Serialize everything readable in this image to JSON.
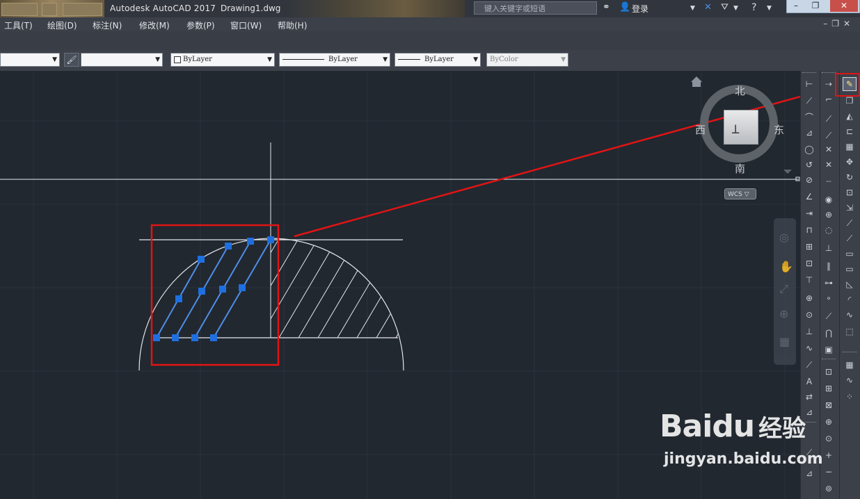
{
  "titlebar": {
    "app_title": "Autodesk AutoCAD 2017",
    "doc_name": "Drawing1.dwg",
    "search_placeholder": "键入关键字或短语",
    "login_label": "登录"
  },
  "menu": {
    "items": [
      "工具(T)",
      "绘图(D)",
      "标注(N)",
      "修改(M)",
      "参数(P)",
      "窗口(W)",
      "帮助(H)"
    ]
  },
  "properties": {
    "color": "ByLayer",
    "linetype": "ByLayer",
    "lineweight": "ByLayer",
    "plotstyle": "ByColor"
  },
  "viewcube": {
    "north": "北",
    "south": "南",
    "east": "东",
    "west": "西",
    "wcs": "WCS"
  },
  "watermark": {
    "brand": "Bai",
    "brand_cn": "经验",
    "url": "jingyan.baidu.com"
  },
  "colors": {
    "background": "#212830",
    "grid": "#2b323b",
    "highlight_red": "#e11414",
    "grip_blue": "#1e6fe0",
    "selected_line": "#4f8ee8"
  }
}
